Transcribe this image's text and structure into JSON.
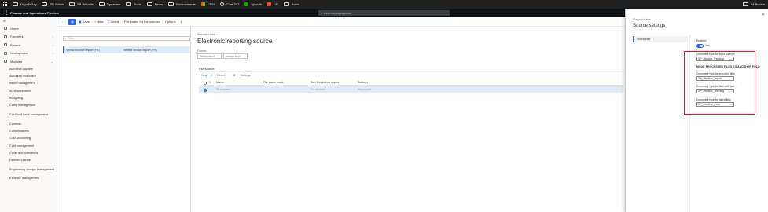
{
  "browser": {
    "bookmarks": [
      {
        "label": "DaysToDay",
        "icon": "folder-icon"
      },
      {
        "label": "SB Admin",
        "icon": "folder-icon"
      },
      {
        "label": "SB Website",
        "icon": "folder-icon"
      },
      {
        "label": "Dynamics",
        "icon": "folder-icon"
      },
      {
        "label": "Tools",
        "icon": "folder-icon"
      },
      {
        "label": "Perso",
        "icon": "folder-icon"
      },
      {
        "label": "Environments",
        "icon": "folder-icon"
      },
      {
        "label": "CRM",
        "icon": "microsoft-icon"
      },
      {
        "label": "ChatGPT",
        "icon": "chatgpt-icon"
      },
      {
        "label": "Upwork",
        "icon": "upwork-icon"
      },
      {
        "label": "CP",
        "icon": "cp-icon"
      },
      {
        "label": "Sales",
        "icon": "folder-icon"
      }
    ],
    "all_bookmarks": "All Bookm"
  },
  "app": {
    "title": "Finance and Operations Preview",
    "search_placeholder": "electronic report sourc"
  },
  "nav": {
    "top": [
      {
        "label": "Home",
        "icon": "home-icon"
      },
      {
        "label": "Favorites",
        "icon": "star-icon"
      },
      {
        "label": "Recent",
        "icon": "clock-icon"
      },
      {
        "label": "Workspaces",
        "icon": "workspace-icon"
      },
      {
        "label": "Modules",
        "icon": "list-icon"
      }
    ],
    "modules": [
      "Accounts payable",
      "Accounts receivable",
      "Asset management",
      "Audit workbench",
      "Budgeting",
      "Camp management",
      "Cash and bank management",
      "Common",
      "Consolidations",
      "Cost accounting",
      "Cost management",
      "Credit and collections",
      "Demand planner",
      "Engineering change management",
      "Expense management"
    ]
  },
  "toolbar": {
    "save": "Save",
    "new": "New",
    "delete": "Delete",
    "file_states": "File states for the sources",
    "options": "Options"
  },
  "list": {
    "filter_placeholder": "Filter",
    "row": {
      "col1": "Vendor invoice import (FR)",
      "col2": "Vendor invoice import (FR)"
    }
  },
  "form": {
    "standard_view": "Standard view",
    "title": "Electronic reporting source",
    "format_label": "Format",
    "format_values": [
      "Vendor invoi...",
      "Vendor invoi..."
    ],
    "file_source_title": "File source",
    "fs_toolbar": {
      "new": "+ New",
      "delete": "Delete",
      "settings": "Settings"
    },
    "grid_headers": {
      "name": "Name",
      "mask": "File name mask",
      "sort": "Sort files before import",
      "settings": "Settings"
    },
    "grid_row": {
      "name": "Sharepoint",
      "mask": "",
      "sort": "Do not sort",
      "settings": "Sharepoint"
    }
  },
  "panel": {
    "standard_view": "Standard view",
    "title": "Source settings",
    "nav_item": "Sharepoint",
    "enabled_label": "Enabled",
    "enabled_value": "Yes",
    "input_label": "Document type for input sources",
    "input_value": "SP_Vendinv_Pending",
    "move_heading": "MOVE PROCESSED FILES TO ANOTHER FOLD",
    "imported_label": "Document type for imported files",
    "imported_value": "SP_VendInv_Import...",
    "warning_label": "Document type for files with war...",
    "warning_value": "SP_VendInv_Warning",
    "failed_label": "Document type for failed files",
    "failed_value": "SP_VendInv_Error"
  },
  "colors": {
    "accent": "#2266e3",
    "highlight": "#e81123"
  }
}
